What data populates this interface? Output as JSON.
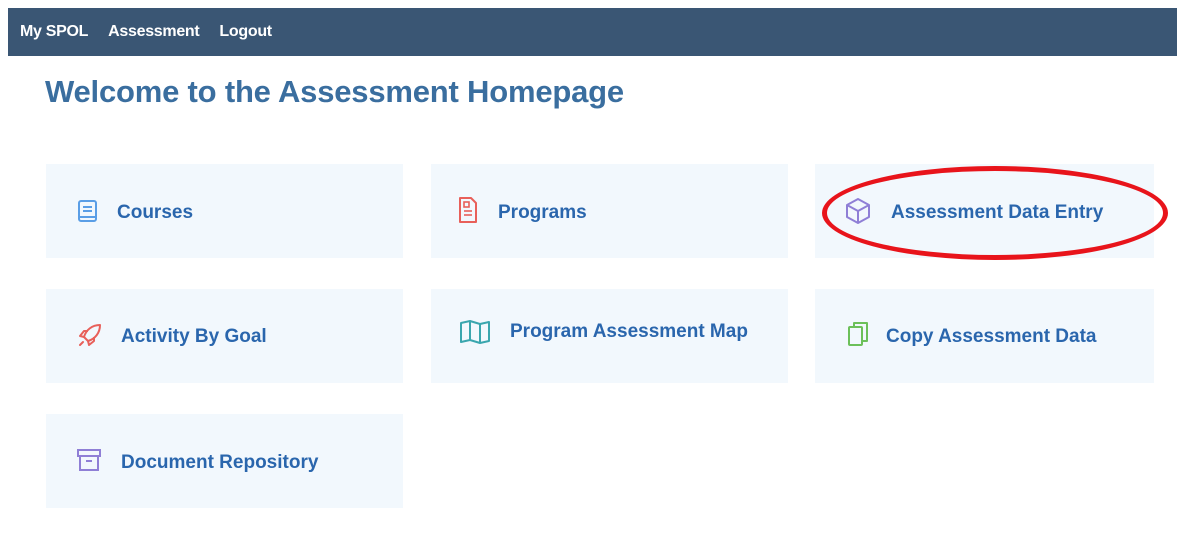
{
  "nav": {
    "items": [
      {
        "label": "My SPOL"
      },
      {
        "label": "Assessment"
      },
      {
        "label": "Logout"
      }
    ]
  },
  "page": {
    "title": "Welcome to the Assessment Homepage"
  },
  "tiles": [
    {
      "label": "Courses",
      "icon": "book-icon",
      "color": "#5a9ee6"
    },
    {
      "label": "Programs",
      "icon": "document-icon",
      "color": "#e8605a"
    },
    {
      "label": "Assessment Data Entry",
      "icon": "cube-icon",
      "color": "#8f7fd6"
    },
    {
      "label": "Activity By Goal",
      "icon": "rocket-icon",
      "color": "#e8605a"
    },
    {
      "label": "Program Assessment Map",
      "icon": "map-icon",
      "color": "#3aa6ae"
    },
    {
      "label": "Copy Assessment Data",
      "icon": "copy-icon",
      "color": "#6cc05a"
    },
    {
      "label": "Document Repository",
      "icon": "archive-icon",
      "color": "#8f7fd6"
    }
  ],
  "colors": {
    "topbar": "#3a5674",
    "title": "#3a6e9f",
    "tile_bg": "#f2f8fd",
    "tile_text": "#2a66ad",
    "highlight": "#e8141b"
  }
}
